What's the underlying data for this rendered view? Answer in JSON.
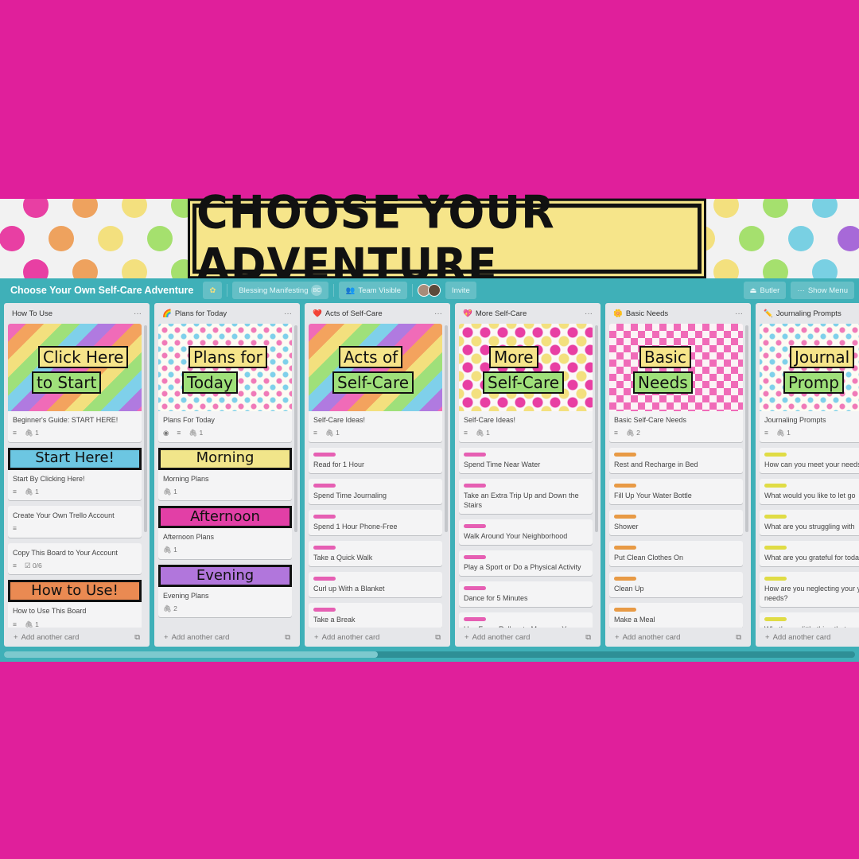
{
  "banner": {
    "title": "CHOOSE YOUR ADVENTURE",
    "dot_colors": [
      "#e83fa3",
      "#eea25e",
      "#f3e07e",
      "#a5e06e",
      "#79d0e3",
      "#a769d8"
    ]
  },
  "toolbar": {
    "board_title": "Choose Your Own Self-Care Adventure",
    "star_icon": "star-icon",
    "team": "Blessing Manifesting",
    "team_badge": "BC",
    "visibility": "Team Visible",
    "invite": "Invite",
    "butler": "Butler",
    "show_menu": "Show Menu"
  },
  "colors": {
    "background": "#e01f9b",
    "board": "#3fb0b8",
    "pink_label": "#e65fb3",
    "orange_label": "#e89a45",
    "yellow_label": "#e0dc45"
  },
  "lists": [
    {
      "title": "How To Use",
      "emoji": "",
      "cover": {
        "lines": [
          "Click Here",
          "to Start"
        ],
        "style": "stripes"
      },
      "cards": [
        {
          "type": "cover",
          "title": "Beginner's Guide: START HERE!",
          "badges": [
            "description",
            "attachment 1"
          ]
        },
        {
          "type": "banner",
          "banner": "Start Here!",
          "color": "#6cc6e2",
          "title": "Start By Clicking Here!",
          "badges": [
            "description",
            "attachment 1"
          ]
        },
        {
          "type": "plain",
          "title": "Create Your Own Trello Account",
          "badges": [
            "description"
          ]
        },
        {
          "type": "plain",
          "title": "Copy This Board to Your Account",
          "badges": [
            "description",
            "checklist 0/6"
          ]
        },
        {
          "type": "banner",
          "banner": "How to Use!",
          "color": "#ea8a52",
          "title": "How to Use This Board",
          "badges": [
            "description",
            "attachment 1"
          ]
        }
      ]
    },
    {
      "title": "Plans for Today",
      "emoji": "🌈",
      "cover": {
        "lines": [
          "Plans for",
          "Today"
        ],
        "style": "hearts"
      },
      "cards": [
        {
          "type": "cover",
          "title": "Plans For Today",
          "badges": [
            "watch",
            "description",
            "attachment 1"
          ]
        },
        {
          "type": "banner",
          "banner": "Morning",
          "color": "#f1e58a",
          "title": "Morning Plans",
          "badges": [
            "attachment 1"
          ]
        },
        {
          "type": "banner",
          "banner": "Afternoon",
          "color": "#e23fa6",
          "title": "Afternoon Plans",
          "badges": [
            "attachment 1"
          ]
        },
        {
          "type": "banner",
          "banner": "Evening",
          "color": "#b176dc",
          "title": "Evening Plans",
          "badges": [
            "attachment 2"
          ]
        }
      ]
    },
    {
      "title": "Acts of Self-Care",
      "emoji": "❤️",
      "cover": {
        "lines": [
          "Acts of",
          "Self-Care"
        ],
        "style": "stripes"
      },
      "label": "#e65fb3",
      "cards": [
        {
          "type": "cover",
          "title": "Self-Care Ideas!",
          "badges": [
            "description",
            "attachment 1"
          ]
        },
        {
          "type": "label",
          "title": "Read for 1 Hour"
        },
        {
          "type": "label",
          "title": "Spend Time Journaling"
        },
        {
          "type": "label",
          "title": "Spend 1 Hour Phone-Free"
        },
        {
          "type": "label",
          "title": "Take a Quick Walk"
        },
        {
          "type": "label",
          "title": "Curl up With a Blanket"
        },
        {
          "type": "label",
          "title": "Take a Break"
        },
        {
          "type": "label",
          "title": ""
        }
      ]
    },
    {
      "title": "More Self-Care",
      "emoji": "💖",
      "cover": {
        "lines": [
          "More",
          "Self-Care"
        ],
        "style": "dots"
      },
      "label": "#e65fb3",
      "cards": [
        {
          "type": "cover",
          "title": "Self-Care Ideas!",
          "badges": [
            "description",
            "attachment 1"
          ]
        },
        {
          "type": "label",
          "title": "Spend Time Near Water"
        },
        {
          "type": "label",
          "title": "Take an Extra Trip Up and Down the Stairs"
        },
        {
          "type": "label",
          "title": "Walk Around Your Neighborhood"
        },
        {
          "type": "label",
          "title": "Play a Sport or Do a Physical Activity"
        },
        {
          "type": "label",
          "title": "Dance for 5 Minutes"
        },
        {
          "type": "label",
          "title": "Use Foam Rollers to Massage Your Muscles"
        }
      ]
    },
    {
      "title": "Basic Needs",
      "emoji": "🌼",
      "cover": {
        "lines": [
          "Basic",
          "Needs"
        ],
        "style": "checks"
      },
      "label": "#e89a45",
      "cards": [
        {
          "type": "cover",
          "title": "Basic Self-Care Needs",
          "badges": [
            "description",
            "attachment 2"
          ]
        },
        {
          "type": "label",
          "title": "Rest and Recharge in Bed"
        },
        {
          "type": "label",
          "title": "Fill Up Your Water Bottle"
        },
        {
          "type": "label",
          "title": "Shower"
        },
        {
          "type": "label",
          "title": "Put Clean Clothes On"
        },
        {
          "type": "label",
          "title": "Clean Up"
        },
        {
          "type": "label",
          "title": "Make a Meal"
        },
        {
          "type": "label",
          "title": ""
        }
      ]
    },
    {
      "title": "Journaling Prompts",
      "emoji": "✏️",
      "cover": {
        "lines": [
          "Journal",
          "Promp"
        ],
        "style": "hearts"
      },
      "label": "#e0dc45",
      "cards": [
        {
          "type": "cover",
          "title": "Journaling Prompts",
          "badges": [
            "description",
            "attachment 1"
          ]
        },
        {
          "type": "label",
          "title": "How can you meet your needs today?"
        },
        {
          "type": "label",
          "title": "What would you like to let go"
        },
        {
          "type": "label",
          "title": "What are you struggling with"
        },
        {
          "type": "label",
          "title": "What are you grateful for today"
        },
        {
          "type": "label",
          "title": "How are you neglecting your your needs?"
        },
        {
          "type": "label",
          "title": "What's one little thing that y"
        }
      ]
    }
  ],
  "add_card": "Add another card",
  "horizontal_scroll_position": 0.0
}
